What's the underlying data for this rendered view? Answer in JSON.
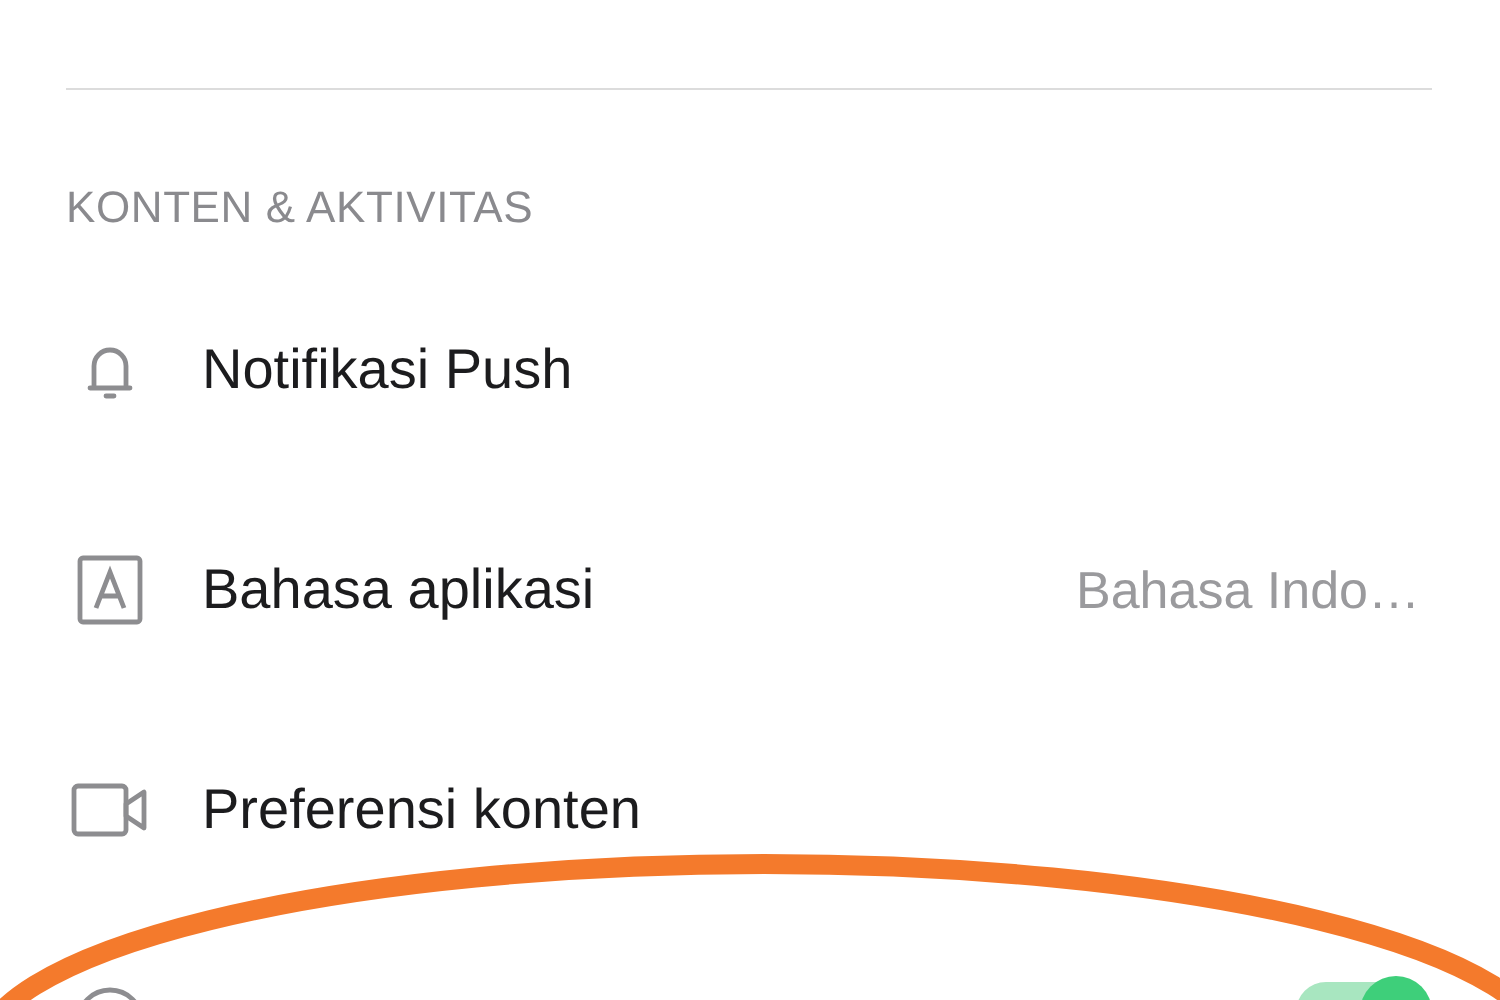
{
  "section": {
    "title": "KONTEN & AKTIVITAS"
  },
  "rows": [
    {
      "kind": "link",
      "label": "Notifikasi Push"
    },
    {
      "kind": "value",
      "label": "Bahasa aplikasi",
      "value": "Bahasa Indo…"
    },
    {
      "kind": "link",
      "label": "Preferensi konten"
    },
    {
      "kind": "toggle",
      "on": true
    }
  ],
  "highlight": {
    "kind": "ellipse"
  }
}
